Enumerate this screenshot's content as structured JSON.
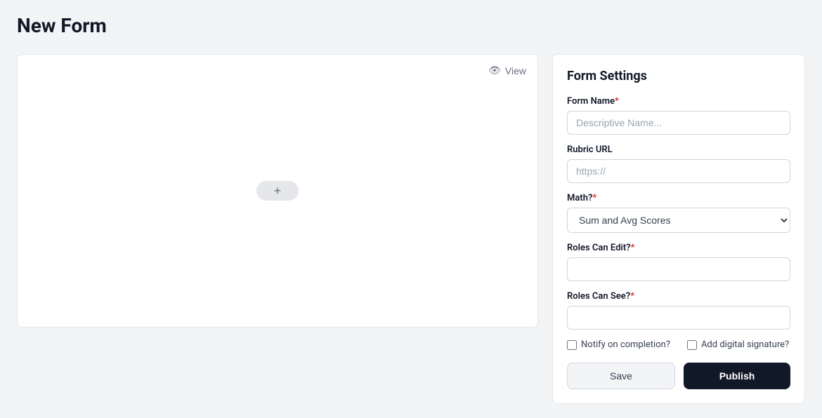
{
  "page": {
    "title": "New Form"
  },
  "canvas": {
    "view_button_label": "View",
    "add_button_label": "+"
  },
  "settings": {
    "title": "Form Settings",
    "form_name": {
      "label": "Form Name",
      "required": true,
      "placeholder": "Descriptive Name..."
    },
    "rubric_url": {
      "label": "Rubric URL",
      "required": false,
      "placeholder": "https://"
    },
    "math": {
      "label": "Math?",
      "required": true,
      "options": [
        "Sum and Avg Scores"
      ],
      "selected": "Sum and Avg Scores"
    },
    "roles_can_edit": {
      "label": "Roles Can Edit?",
      "required": true,
      "placeholder": ""
    },
    "roles_can_see": {
      "label": "Roles Can See?",
      "required": true,
      "placeholder": ""
    },
    "notify_on_completion": {
      "label": "Notify on completion?",
      "checked": false
    },
    "add_digital_signature": {
      "label": "Add digital signature?",
      "checked": false
    },
    "save_label": "Save",
    "publish_label": "Publish"
  }
}
